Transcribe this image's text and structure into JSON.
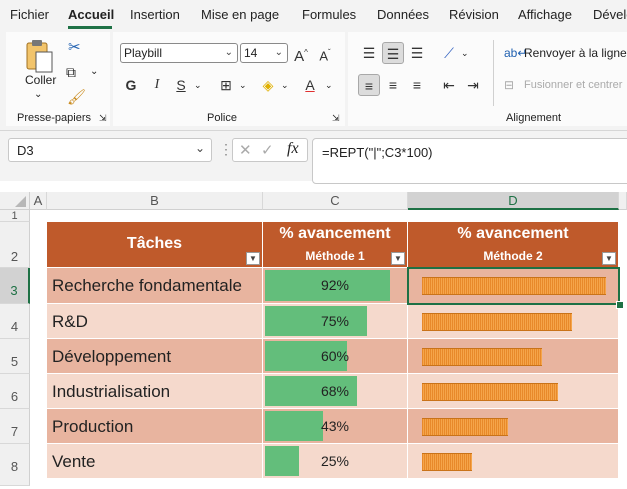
{
  "menu": {
    "tabs": [
      "Fichier",
      "Accueil",
      "Insertion",
      "Mise en page",
      "Formules",
      "Données",
      "Révision",
      "Affichage",
      "Dévelo"
    ],
    "active": "Accueil"
  },
  "ribbon": {
    "clipboard": {
      "paste_label": "Coller",
      "group_label": "Presse-papiers"
    },
    "font": {
      "font_name": "Playbill",
      "font_size": "14",
      "bold": "G",
      "italic": "I",
      "underline": "S",
      "group_label": "Police"
    },
    "alignment": {
      "wrap_label": "Renvoyer à la ligne a",
      "merge_label": "Fusionner et centrer",
      "group_label": "Alignement"
    }
  },
  "formula_bar": {
    "name_box": "D3",
    "fx": "fx",
    "formula": "=REPT(\"|\";C3*100)"
  },
  "sheet": {
    "columns": [
      "A",
      "B",
      "C",
      "D"
    ],
    "rows": [
      "1",
      "2",
      "3",
      "4",
      "5",
      "6",
      "7",
      "8"
    ],
    "header": {
      "task": "Tâches",
      "c_title": "% avancement",
      "c_sub": "Méthode 1",
      "d_title": "% avancement",
      "d_sub": "Méthode 2"
    },
    "tasks": [
      {
        "name": "Recherche fondamentale",
        "pct_label": "92%",
        "value": 0.92
      },
      {
        "name": "R&D",
        "pct_label": "75%",
        "value": 0.75
      },
      {
        "name": "Développement",
        "pct_label": "60%",
        "value": 0.6
      },
      {
        "name": "Industrialisation",
        "pct_label": "68%",
        "value": 0.68
      },
      {
        "name": "Production",
        "pct_label": "43%",
        "value": 0.43
      },
      {
        "name": "Vente",
        "pct_label": "25%",
        "value": 0.25
      }
    ],
    "colors": {
      "header": "#bf5a2b",
      "row_dark": "#e8b49f",
      "row_light": "#f5d9cc",
      "databar": "#63be7b",
      "rept": "#e8892a",
      "selection": "#1e7145"
    }
  }
}
